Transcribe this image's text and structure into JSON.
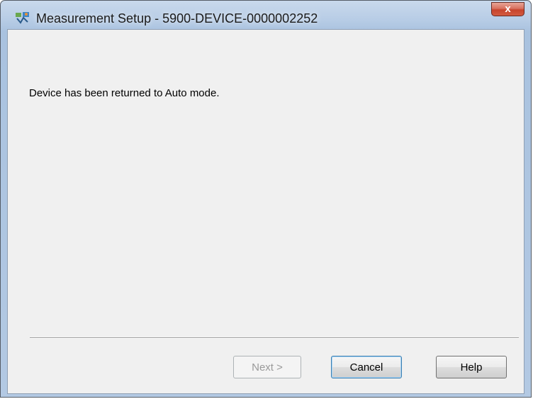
{
  "window": {
    "title": "Measurement Setup - 5900-DEVICE-0000002252",
    "app_icon": "measurement-app-icon",
    "close_icon": "close-icon",
    "close_glyph": "x"
  },
  "content": {
    "message": "Device has been returned to Auto mode."
  },
  "buttons": {
    "next": "Next >",
    "cancel": "Cancel",
    "help": "Help"
  }
}
